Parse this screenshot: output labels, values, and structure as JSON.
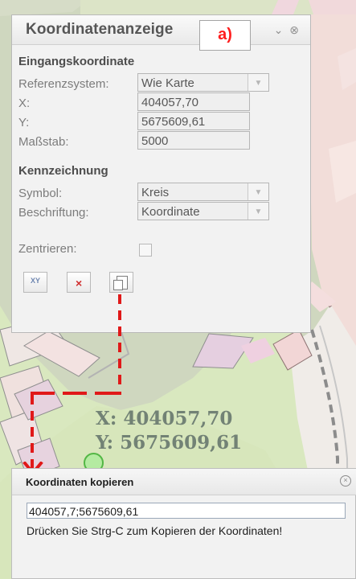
{
  "panel": {
    "title": "Koordinatenanzeige",
    "badge": "a)",
    "section_input": "Eingangskoordinate",
    "reference_label": "Referenzsystem:",
    "reference_value": "Wie Karte",
    "x_label": "X:",
    "x_value": "404057,70",
    "y_label": "Y:",
    "y_value": "5675609,61",
    "scale_label": "Maßstab:",
    "scale_value": "5000",
    "section_marking": "Kennzeichnung",
    "symbol_label": "Symbol:",
    "symbol_value": "Kreis",
    "caption_label": "Beschriftung:",
    "caption_value": "Koordinate",
    "center_label": "Zentrieren:"
  },
  "map": {
    "x_overlay": "X: 404057,70",
    "y_overlay": "Y: 5675609,61"
  },
  "dialog": {
    "title": "Koordinaten kopieren",
    "input_value": "404057,7;5675609,61",
    "note": "Drücken Sie Strg-C zum Kopieren der Koordinaten!"
  }
}
